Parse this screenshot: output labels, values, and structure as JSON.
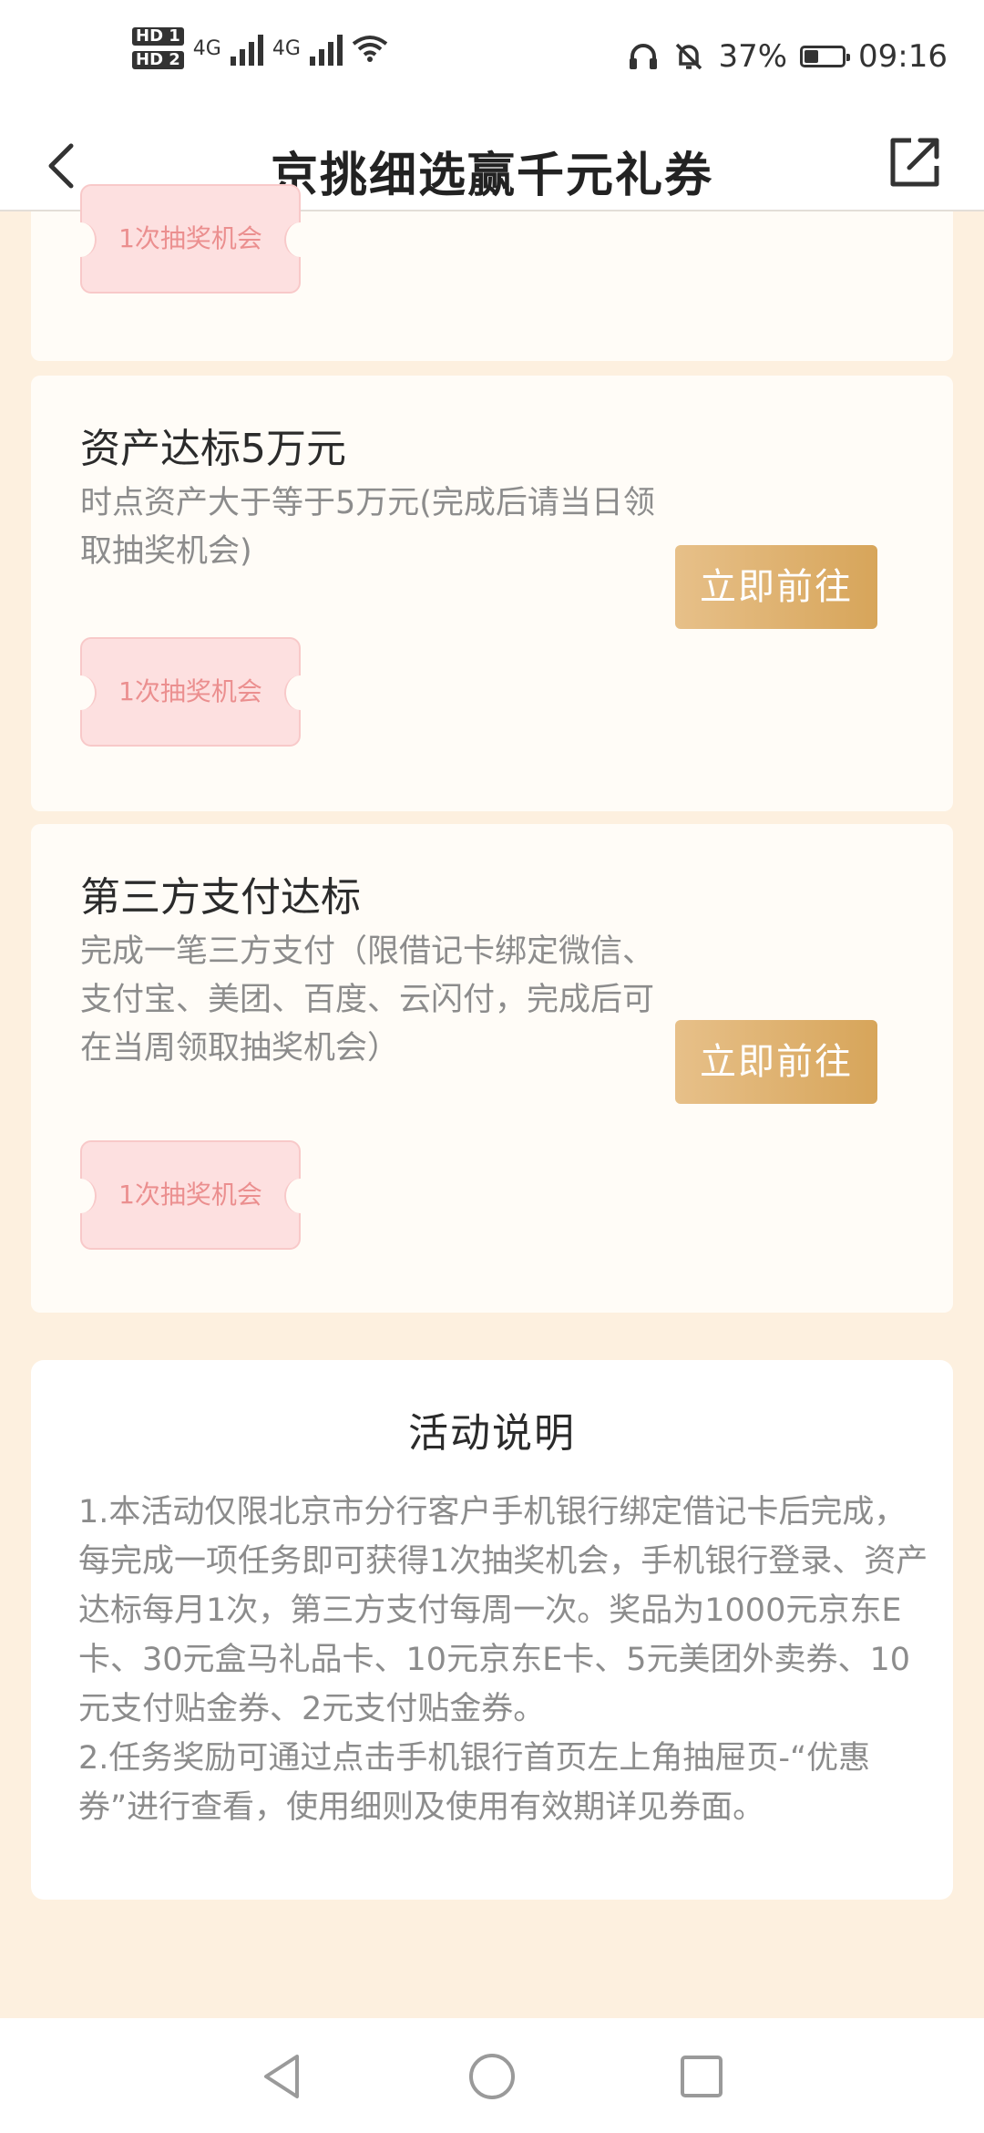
{
  "status_bar": {
    "hd1": "HD 1",
    "hd2": "HD 2",
    "net1": "4G",
    "net2": "4G",
    "battery_percent": "37%",
    "battery_level": 0.37,
    "time": "09:16"
  },
  "header": {
    "title": "京挑细选赢千元礼券",
    "back_icon": "chevron-left-icon",
    "share_icon": "share-icon"
  },
  "tasks": [
    {
      "reward": "1次抽奖机会"
    },
    {
      "title": "资产达标5万元",
      "description": "时点资产大于等于5万元(完成后请当日领取抽奖机会)",
      "button": "立即前往",
      "reward": "1次抽奖机会"
    },
    {
      "title": "第三方支付达标",
      "description": "完成一笔三方支付（限借记卡绑定微信、支付宝、美团、百度、云闪付，完成后可在当周领取抽奖机会）",
      "button": "立即前往",
      "reward": "1次抽奖机会"
    }
  ],
  "rules": {
    "title": "活动说明",
    "items": [
      "1.本活动仅限北京市分行客户手机银行绑定借记卡后完成，每完成一项任务即可获得1次抽奖机会，手机银行登录、资产达标每月1次，第三方支付每周一次。奖品为1000元京东E卡、30元盒马礼品卡、10元京东E卡、5元美团外卖券、10元支付贴金券、2元支付贴金券。",
      "2.任务奖励可通过点击手机银行首页左上角抽屉页-“优惠券”进行查看，使用细则及使用有效期详见券面。"
    ]
  },
  "colors": {
    "background": "#fdf0df",
    "button_gradient_start": "#e7c089",
    "button_gradient_end": "#d7a55a",
    "ticket_bg": "#fde0e0",
    "ticket_text": "#eb8f8f"
  }
}
